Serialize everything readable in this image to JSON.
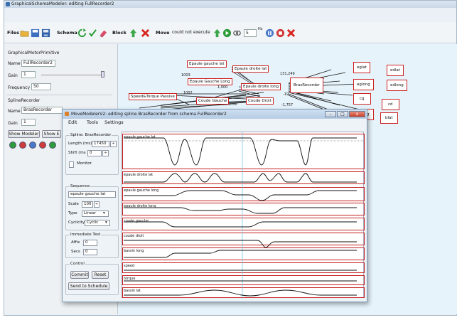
{
  "window": {
    "title": "GraphicalSchemaModeler: editing FullRecorder2"
  },
  "toolbar": {
    "files_label": "Files",
    "schema_label": "Schema",
    "block_label": "Block",
    "move_label": "Move",
    "status_text": "could not execute",
    "speed_value": "5",
    "hz_label": "Hz"
  },
  "left_panel": {
    "motor_title": "GraphicalMotorPrimitive",
    "name_label": "Name",
    "name_value": "FullRecorder2",
    "gain_label": "Gain",
    "gain_value": "1",
    "freq_label": "Frequency",
    "freq_value": "50",
    "spline_title": "SplineRecorder",
    "spline_name_label": "Name",
    "spline_name_value": "BrasRecorder",
    "spline_gain_label": "Gain",
    "spline_gain_value": "1",
    "show_modeler_label": "Show Modeler",
    "show_e_label": "Show E"
  },
  "schema": {
    "nodes": [
      "Epaule gauche lat",
      "Epaule droite lat",
      "Epaule Gauche Long",
      "Epaule droite long",
      "Coude Gauche",
      "Coude Droit",
      "Speed&Torque Passive",
      "BrasRecorder",
      "eglat",
      "edlat",
      "eglong",
      "edlong",
      "cg",
      "cd",
      "blong",
      "blat"
    ],
    "tags": [
      "1003",
      "131,249",
      "1,000",
      "1002",
      "1000",
      "-1,757",
      "-19"
    ]
  },
  "dialog": {
    "title": "MoveModelerV2: editing spline BrasRecorder from schema FullRecorder2",
    "menu": [
      "Edit",
      "Tools",
      "Settings"
    ],
    "spline_group_label": "Spline: BrasRecorder",
    "length_label": "Length (ms)",
    "length_value": "17450",
    "shift_label": "Shift (ms",
    "shift_value": "0",
    "monitor_label": "Monitor",
    "sequence_group_label": "Sequence",
    "sequence_value": "epaule gauche lat",
    "scale_label": "Scale",
    "scale_value": "100",
    "type_label": "Type",
    "type_value": "Linear",
    "cyclicity_label": "Cyclicity",
    "cyclicity_value": "Cyclic",
    "immediate_group_label": "Immediate Test",
    "affix_label": "Affix",
    "affix_value": "0",
    "secs_label": "Secs",
    "secs_value": "0",
    "control_group_label": "Control",
    "commit_label": "Commit",
    "reset_label": "Reset",
    "send_label": "Send to Schedule",
    "lanes": [
      "epaule gauche lat",
      "epaule droite lat",
      "epaule gauche long",
      "epaule droite long",
      "coude gauche",
      "coude droit",
      "bassin long",
      "speed",
      "torque",
      "bassin lat"
    ]
  }
}
